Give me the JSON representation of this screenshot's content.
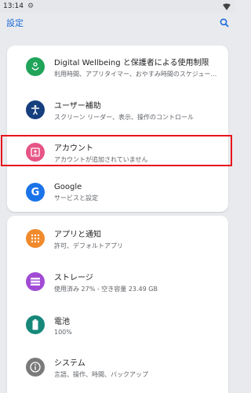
{
  "status": {
    "time": "13:14"
  },
  "appbar": {
    "title": "設定"
  },
  "items_card1": [
    {
      "title": "Digital Wellbeing と保護者による使用制限",
      "subtitle": "利用時間、アプリタイマー、おやすみ時間のスケジュー…",
      "color": "#20a45a",
      "icon": "heart-person-icon"
    },
    {
      "title": "ユーザー補助",
      "subtitle": "スクリーン リーダー、表示、操作のコントロール",
      "color": "#163f7e",
      "icon": "accessibility-icon"
    },
    {
      "title": "アカウント",
      "subtitle": "アカウントが追加されていません",
      "color": "#e65586",
      "icon": "account-icon"
    },
    {
      "title": "Google",
      "subtitle": "サービスと設定",
      "color": "#1a73e8",
      "icon": "google-g-icon"
    }
  ],
  "items_card2": [
    {
      "title": "アプリと通知",
      "subtitle": "許可、デフォルトアプリ",
      "color": "#f08a2c",
      "icon": "apps-grid-icon"
    },
    {
      "title": "ストレージ",
      "subtitle": "使用済み 27% - 空き容量 23.49 GB",
      "color": "#a14bd5",
      "icon": "storage-icon"
    },
    {
      "title": "電池",
      "subtitle": "100%",
      "color": "#16887a",
      "icon": "battery-icon"
    },
    {
      "title": "システム",
      "subtitle": "言語、操作、時間、バックアップ",
      "color": "#7a7a7a",
      "icon": "info-icon"
    }
  ]
}
